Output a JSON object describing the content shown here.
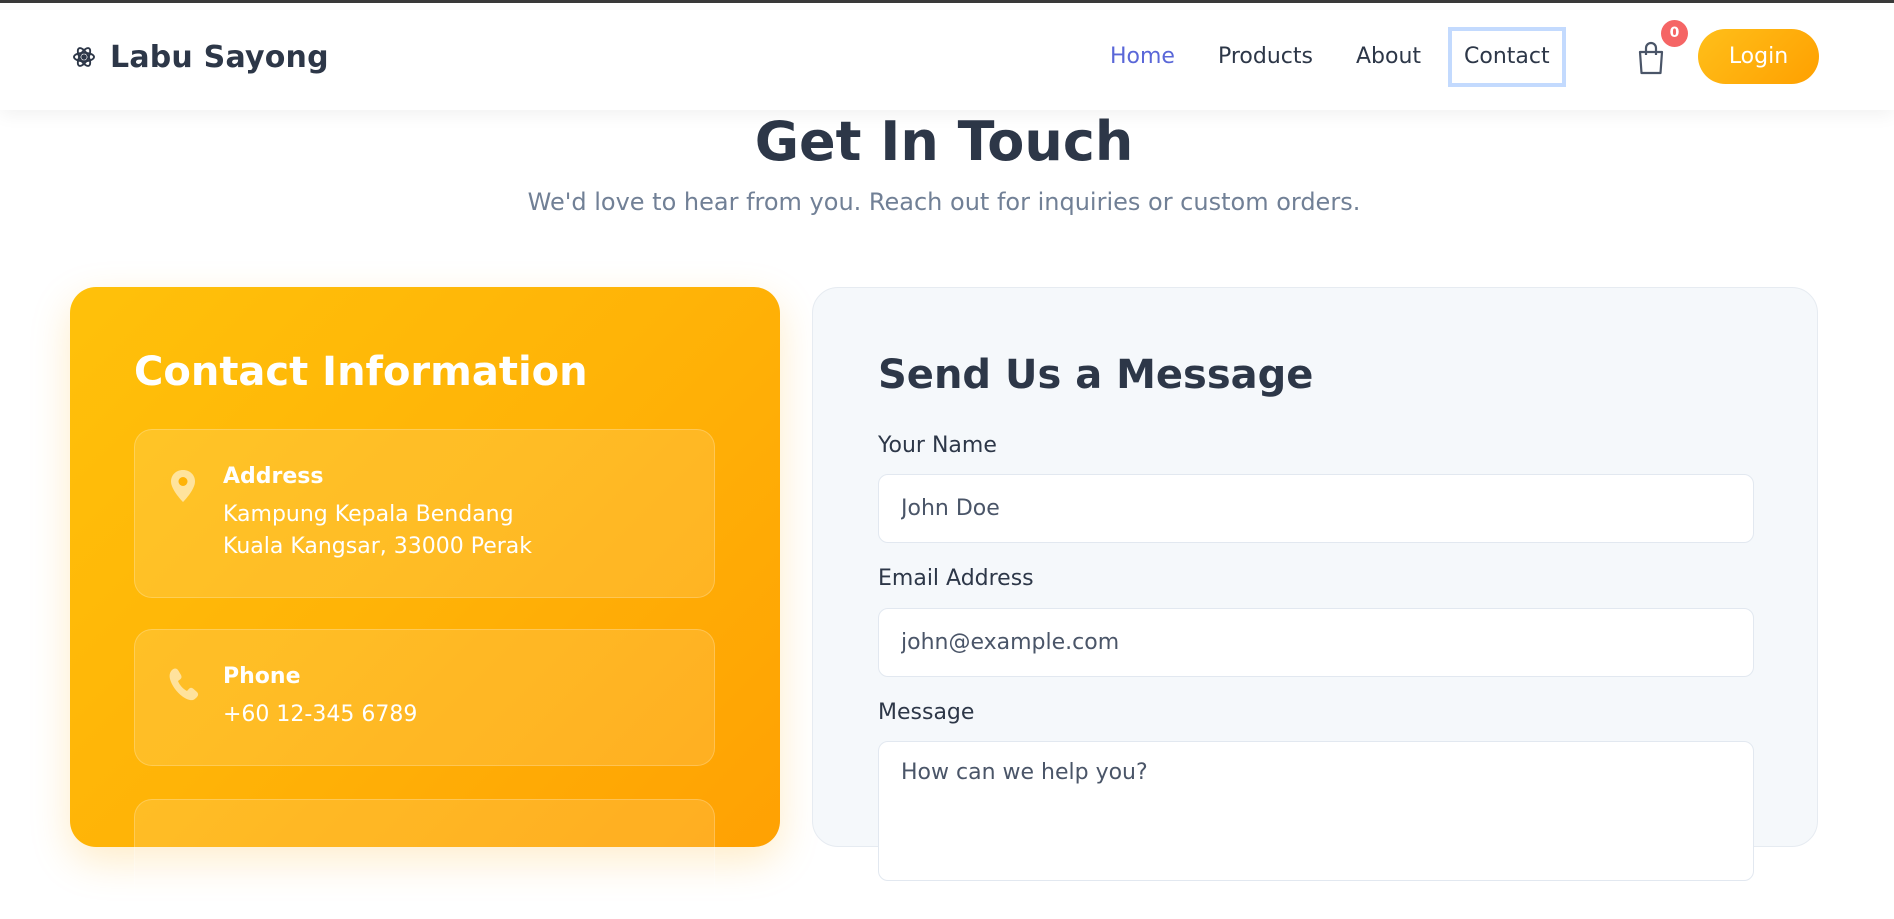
{
  "brand": {
    "name": "Labu Sayong",
    "icon": "atom-icon"
  },
  "nav": {
    "items": [
      {
        "label": "Home",
        "state": "active"
      },
      {
        "label": "Products"
      },
      {
        "label": "About"
      },
      {
        "label": "Contact",
        "state": "focused"
      }
    ]
  },
  "cart": {
    "icon": "shopping-bag-icon",
    "count": "0"
  },
  "login": {
    "label": "Login"
  },
  "hero": {
    "title": "Get In Touch",
    "subtitle": "We'd love to hear from you. Reach out for inquiries or custom orders."
  },
  "contact_info": {
    "title": "Contact Information",
    "address": {
      "icon": "map-pin-icon",
      "label": "Address",
      "line1": "Kampung Kepala Bendang",
      "line2": "Kuala Kangsar, 33000 Perak"
    },
    "phone": {
      "icon": "phone-icon",
      "label": "Phone",
      "value": "+60 12-345 6789"
    }
  },
  "form": {
    "title": "Send Us a Message",
    "name": {
      "label": "Your Name",
      "placeholder": "John Doe"
    },
    "email": {
      "label": "Email Address",
      "placeholder": "john@example.com"
    },
    "message": {
      "label": "Message",
      "placeholder": "How can we help you?"
    }
  },
  "colors": {
    "accent": "#5a67d8",
    "brand_gradient_start": "#ffc10a",
    "brand_gradient_end": "#ffa103",
    "badge": "#f56565",
    "text_dark": "#2d3748",
    "text_muted": "#718096"
  }
}
